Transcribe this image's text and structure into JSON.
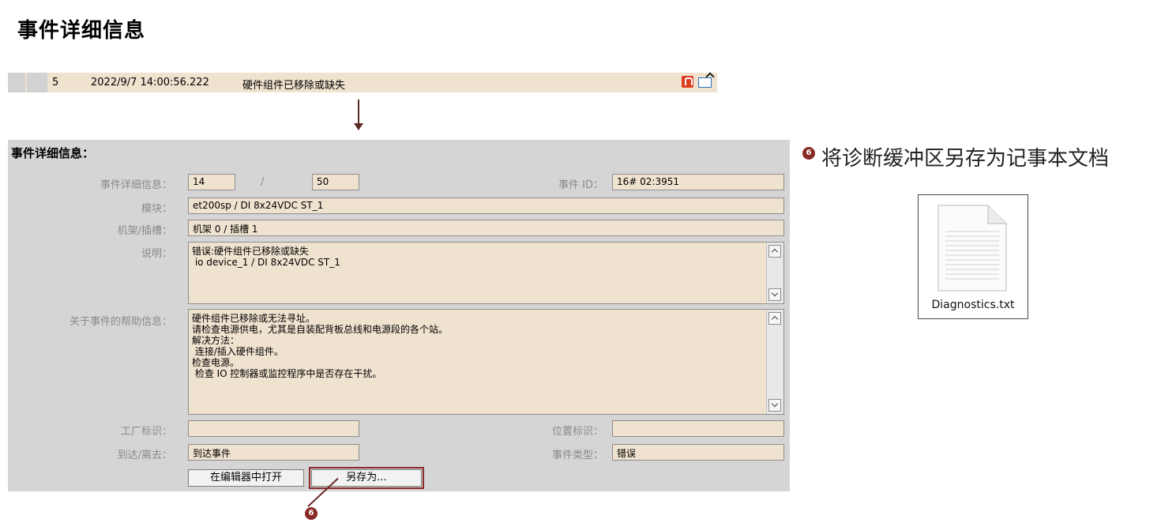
{
  "page_title": "事件详细信息",
  "event_row": {
    "number": "5",
    "timestamp": "2022/9/7 14:00:56.222",
    "text": "硬件组件已移除或缺失"
  },
  "panel": {
    "title": "事件详细信息：",
    "labels": {
      "event_detail": "事件详细信息：",
      "event_id": "事件 ID：",
      "module": "模块：",
      "rack_slot": "机架/插槽：",
      "description": "说明：",
      "help": "关于事件的帮助信息：",
      "plant_id": "工厂标识：",
      "location_id": "位置标识：",
      "arrival": "到达/离去：",
      "event_type": "事件类型："
    },
    "values": {
      "event_index": "14",
      "separator": "/",
      "event_total": "50",
      "event_id": "16# 02:3951",
      "module": "et200sp / DI 8x24VDC ST_1",
      "rack_slot": "机架 0 / 插槽 1",
      "description": "错误:硬件组件已移除或缺失\n io device_1 / DI 8x24VDC ST_1",
      "help": "硬件组件已移除或无法寻址。\n请检查电源供电，尤其是自装配背板总线和电源段的各个站。\n解决方法：\n 连接/插入硬件组件。\n检查电源。\n 检查 IO 控制器或监控程序中是否存在干扰。",
      "plant_id": "",
      "location_id": "",
      "arrival": "到达事件",
      "event_type": "错误"
    },
    "buttons": {
      "open_in_editor": "在编辑器中打开",
      "save_as": "另存为..."
    }
  },
  "callout": {
    "badge": "6",
    "text": "将诊断缓冲区另存为记事本文档"
  },
  "file": {
    "name": "Diagnostics.txt"
  }
}
